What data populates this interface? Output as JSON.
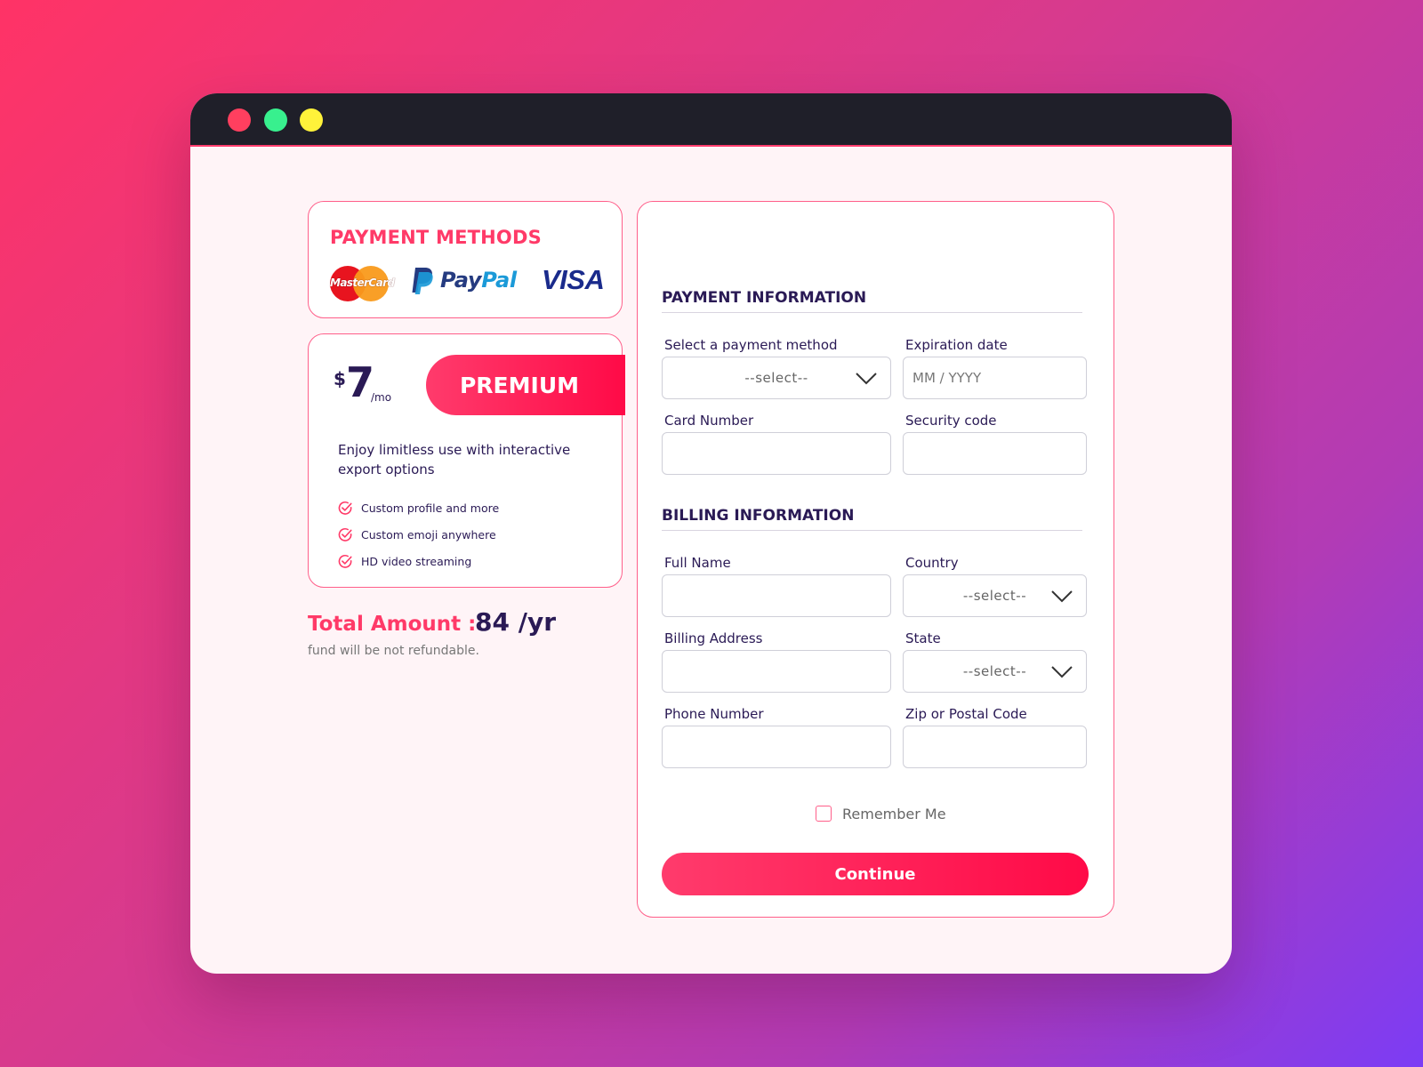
{
  "window_controls": [
    "close",
    "minimize",
    "maximize"
  ],
  "payment_methods": {
    "title": "PAYMENT METHODS",
    "mastercard_label": "MasterCard",
    "paypal_pay": "Pay",
    "paypal_pal": "Pal",
    "visa_label": "VISA"
  },
  "plan": {
    "currency": "$",
    "price": "7",
    "period": "/mo",
    "name": "PREMIUM",
    "description": "Enjoy limitless use with interactive export options",
    "features": [
      "Custom profile and more",
      "Custom emoji anywhere",
      "HD video streaming"
    ]
  },
  "total": {
    "label": "Total Amount :",
    "value": "84 /yr",
    "note": "fund will be not refundable."
  },
  "payment_info": {
    "title": "PAYMENT INFORMATION",
    "method_label": "Select a payment method",
    "method_value": "--select--",
    "expiration_label": "Expiration date",
    "expiration_placeholder": "MM / YYYY",
    "card_label": "Card Number",
    "security_label": "Security code"
  },
  "billing_info": {
    "title": "BILLING INFORMATION",
    "full_name_label": "Full Name",
    "country_label": "Country",
    "country_value": "--select--",
    "address_label": "Billing Address",
    "state_label": "State",
    "state_value": "--select--",
    "phone_label": "Phone Number",
    "zip_label": "Zip or Postal Code"
  },
  "remember_label": "Remember Me",
  "continue_label": "Continue",
  "colors": {
    "accent": "#ff3a68",
    "navy": "#2a1a55",
    "titlebar": "#1f1f29",
    "card_border": "#ff5f8a"
  }
}
